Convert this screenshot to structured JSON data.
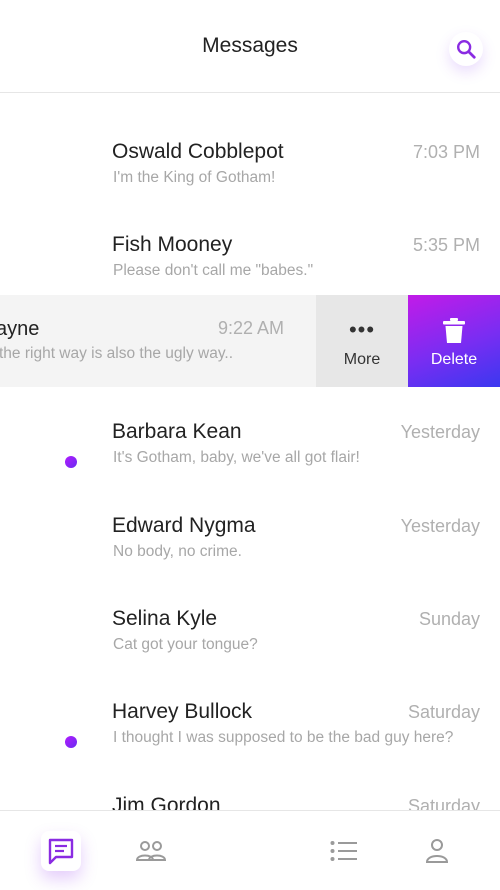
{
  "header": {
    "title": "Messages",
    "search_icon": "search-icon"
  },
  "accent_color": "#8a2be2",
  "messages": [
    {
      "name": "Oswald Cobblepot",
      "preview": "I'm the King of Gotham!",
      "time": "7:03 PM",
      "unread": false
    },
    {
      "name": "Fish Mooney",
      "preview": "Please don't call me \"babes.\"",
      "time": "5:35 PM",
      "unread": false
    },
    {
      "name": "ayne",
      "preview": "the right way is also the ugly way..",
      "time": "9:22 AM",
      "unread": false,
      "swiped": true
    },
    {
      "name": "Barbara Kean",
      "preview": "It's Gotham, baby, we've all got flair!",
      "time": "Yesterday",
      "unread": true
    },
    {
      "name": "Edward Nygma",
      "preview": "No body, no crime.",
      "time": "Yesterday",
      "unread": false
    },
    {
      "name": "Selina Kyle",
      "preview": "Cat got your tongue?",
      "time": "Sunday",
      "unread": false
    },
    {
      "name": "Harvey Bullock",
      "preview": "I thought I was supposed to be the bad guy here?",
      "time": "Saturday",
      "unread": true
    },
    {
      "name": "Jim Gordon",
      "preview": "",
      "time": "Saturday",
      "unread": false
    }
  ],
  "swipe_actions": {
    "more_label": "More",
    "delete_label": "Delete",
    "more_icon": "more-dots-icon",
    "delete_icon": "trash-icon"
  },
  "tabbar": [
    {
      "icon": "chat-icon",
      "active": true
    },
    {
      "icon": "contacts-icon",
      "active": false
    },
    {
      "icon": "list-icon",
      "active": false
    },
    {
      "icon": "profile-icon",
      "active": false
    }
  ]
}
